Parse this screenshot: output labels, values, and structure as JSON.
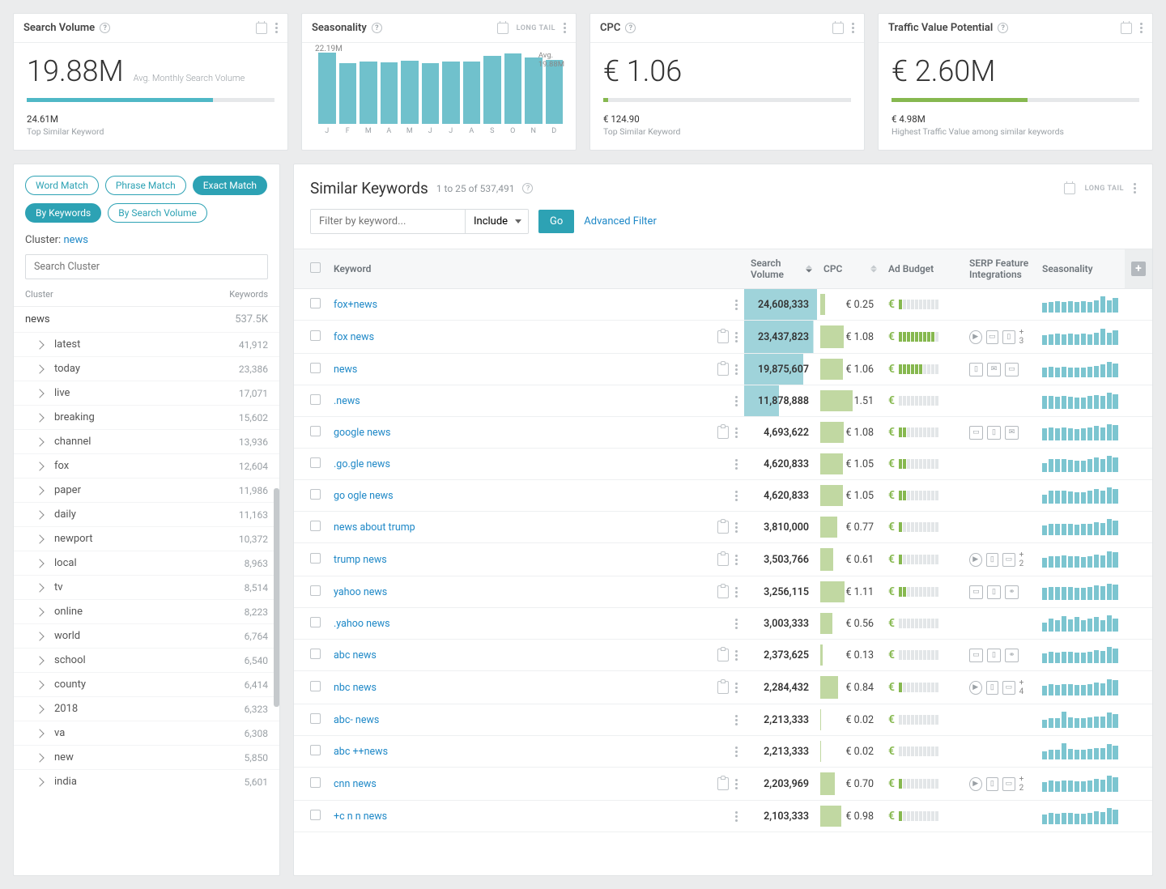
{
  "cards": {
    "searchVolume": {
      "title": "Search Volume",
      "value": "19.88M",
      "sub": "Avg. Monthly Search Volume",
      "foot": "24.61M",
      "footSub": "Top Similar Keyword",
      "fill": 75
    },
    "seasonality": {
      "title": "Seasonality",
      "peak": "22.19M",
      "avgLabel": "Avg.",
      "avg": "19.88M"
    },
    "cpc": {
      "title": "CPC",
      "value": "€ 1.06",
      "foot": "€ 124.90",
      "footSub": "Top Similar Keyword",
      "fill": 2
    },
    "traffic": {
      "title": "Traffic Value Potential",
      "value": "€ 2.60M",
      "foot": "€ 4.98M",
      "footSub": "Highest Traffic Value among similar keywords",
      "fill": 55
    }
  },
  "chart_data": {
    "type": "bar",
    "categories": [
      "J",
      "F",
      "M",
      "A",
      "M",
      "J",
      "J",
      "A",
      "S",
      "O",
      "N",
      "D"
    ],
    "values": [
      22.19,
      18.9,
      19.5,
      19.1,
      19.6,
      19.0,
      19.4,
      19.3,
      21.3,
      22.0,
      20.8,
      20.0
    ],
    "title": "Seasonality",
    "ylim": [
      0,
      22.19
    ],
    "avg": 19.88
  },
  "sidebar": {
    "match": {
      "word": "Word Match",
      "phrase": "Phrase Match",
      "exact": "Exact Match"
    },
    "by": {
      "keywords": "By Keywords",
      "volume": "By Search Volume"
    },
    "clusterLabel": "Cluster:",
    "clusterValue": "news",
    "searchPlaceholder": "Search Cluster",
    "headCluster": "Cluster",
    "headKw": "Keywords",
    "root": {
      "name": "news",
      "count": "537.5K"
    },
    "items": [
      {
        "name": "latest",
        "count": "41,912"
      },
      {
        "name": "today",
        "count": "23,386"
      },
      {
        "name": "live",
        "count": "17,071"
      },
      {
        "name": "breaking",
        "count": "15,602"
      },
      {
        "name": "channel",
        "count": "13,936"
      },
      {
        "name": "fox",
        "count": "12,604"
      },
      {
        "name": "paper",
        "count": "11,986"
      },
      {
        "name": "daily",
        "count": "11,163"
      },
      {
        "name": "newport",
        "count": "10,372"
      },
      {
        "name": "local",
        "count": "8,963"
      },
      {
        "name": "tv",
        "count": "8,514"
      },
      {
        "name": "online",
        "count": "8,223"
      },
      {
        "name": "world",
        "count": "6,764"
      },
      {
        "name": "school",
        "count": "6,540"
      },
      {
        "name": "county",
        "count": "6,414"
      },
      {
        "name": "2018",
        "count": "6,323"
      },
      {
        "name": "va",
        "count": "6,308"
      },
      {
        "name": "new",
        "count": "5,850"
      },
      {
        "name": "india",
        "count": "5,601"
      }
    ]
  },
  "main": {
    "title": "Similar Keywords",
    "count": "1 to 25 of 537,491",
    "filterPlaceholder": "Filter by keyword...",
    "include": "Include",
    "go": "Go",
    "advanced": "Advanced Filter",
    "longtail": "LONG TAIL",
    "headers": {
      "keyword": "Keyword",
      "sv": "Search Volume",
      "cpc": "CPC",
      "budget": "Ad Budget",
      "serp": "SERP Feature Integrations",
      "season": "Seasonality"
    }
  },
  "rows": [
    {
      "kw": "fox+news",
      "sv": "24,608,333",
      "svw": 100,
      "cpc": "€ 0.25",
      "cw": 8,
      "bud": 1,
      "serp": [],
      "more": "",
      "s": [
        60,
        64,
        68,
        66,
        70,
        66,
        68,
        66,
        74,
        100,
        76,
        90
      ],
      "clip": false
    },
    {
      "kw": "fox news",
      "sv": "23,437,823",
      "svw": 95,
      "cpc": "€ 1.08",
      "cw": 36,
      "bud": 9,
      "serp": [
        "play",
        "card",
        "phone"
      ],
      "more": "+ 3",
      "s": [
        60,
        64,
        68,
        66,
        70,
        66,
        68,
        66,
        74,
        100,
        76,
        90
      ],
      "clip": true
    },
    {
      "kw": "news",
      "sv": "19,875,607",
      "svw": 81,
      "cpc": "€ 1.06",
      "cw": 35,
      "bud": 6,
      "serp": [
        "phone",
        "chat",
        "card"
      ],
      "more": "",
      "s": [
        58,
        64,
        62,
        64,
        60,
        58,
        60,
        64,
        70,
        78,
        94,
        86
      ],
      "clip": true
    },
    {
      "kw": ".news",
      "sv": "11,878,888",
      "svw": 48,
      "cpc": "€ 1.51",
      "cw": 50,
      "bud": 0,
      "serp": [],
      "more": "",
      "s": [
        78,
        82,
        74,
        78,
        76,
        72,
        70,
        78,
        86,
        80,
        100,
        92
      ],
      "clip": false
    },
    {
      "kw": "google news",
      "sv": "4,693,622",
      "svw": 19,
      "cpc": "€ 1.08",
      "cw": 36,
      "bud": 2,
      "serp": [
        "card",
        "phone",
        "chat"
      ],
      "more": "",
      "s": [
        74,
        80,
        76,
        80,
        76,
        72,
        74,
        80,
        88,
        82,
        100,
        94
      ],
      "clip": true
    },
    {
      "kw": ".go.gle news",
      "sv": "4,620,833",
      "svw": 19,
      "cpc": "€ 1.05",
      "cw": 35,
      "bud": 2,
      "serp": [],
      "more": "",
      "s": [
        54,
        80,
        78,
        80,
        74,
        70,
        72,
        78,
        90,
        82,
        100,
        92
      ],
      "clip": false
    },
    {
      "kw": "go ogle news",
      "sv": "4,620,833",
      "svw": 19,
      "cpc": "€ 1.05",
      "cw": 35,
      "bud": 2,
      "serp": [],
      "more": "",
      "s": [
        54,
        80,
        78,
        80,
        74,
        70,
        72,
        78,
        90,
        82,
        100,
        92
      ],
      "clip": false
    },
    {
      "kw": "news about trump",
      "sv": "3,810,000",
      "svw": 15,
      "cpc": "€ 0.77",
      "cw": 26,
      "bud": 1,
      "serp": [],
      "more": "",
      "s": [
        60,
        72,
        68,
        72,
        70,
        66,
        68,
        70,
        78,
        74,
        100,
        92
      ],
      "clip": true
    },
    {
      "kw": "trump news",
      "sv": "3,503,766",
      "svw": 14,
      "cpc": "€ 0.61",
      "cw": 20,
      "bud": 1,
      "serp": [
        "play",
        "phone",
        "card"
      ],
      "more": "+ 2",
      "s": [
        60,
        72,
        70,
        76,
        72,
        68,
        66,
        70,
        78,
        74,
        100,
        94
      ],
      "clip": true
    },
    {
      "kw": "yahoo news",
      "sv": "3,256,115",
      "svw": 13,
      "cpc": "€ 1.11",
      "cw": 37,
      "bud": 2,
      "serp": [
        "card",
        "phone",
        "link"
      ],
      "more": "",
      "s": [
        76,
        82,
        80,
        82,
        78,
        76,
        76,
        80,
        88,
        84,
        100,
        94
      ],
      "clip": true
    },
    {
      "kw": ".yahoo news",
      "sv": "3,003,333",
      "svw": 12,
      "cpc": "€ 0.56",
      "cw": 19,
      "bud": 0,
      "serp": [],
      "more": "",
      "s": [
        56,
        78,
        72,
        94,
        76,
        88,
        72,
        78,
        90,
        70,
        100,
        78
      ],
      "clip": false
    },
    {
      "kw": "abc news",
      "sv": "2,373,625",
      "svw": 10,
      "cpc": "€ 0.13",
      "cw": 4,
      "bud": 0,
      "serp": [
        "card",
        "phone",
        "link"
      ],
      "more": "",
      "s": [
        60,
        68,
        66,
        72,
        68,
        64,
        66,
        70,
        78,
        74,
        100,
        92
      ],
      "clip": true
    },
    {
      "kw": "nbc news",
      "sv": "2,284,432",
      "svw": 9,
      "cpc": "€ 0.84",
      "cw": 28,
      "bud": 1,
      "serp": [
        "play",
        "phone",
        "card"
      ],
      "more": "+ 4",
      "s": [
        60,
        68,
        66,
        72,
        68,
        64,
        66,
        70,
        78,
        74,
        100,
        94
      ],
      "clip": true
    },
    {
      "kw": "abc- news",
      "sv": "2,213,333",
      "svw": 9,
      "cpc": "€ 0.02",
      "cw": 1,
      "bud": 0,
      "serp": [],
      "more": "",
      "s": [
        52,
        62,
        60,
        100,
        64,
        60,
        58,
        64,
        72,
        68,
        94,
        86
      ],
      "clip": false
    },
    {
      "kw": "abc ++news",
      "sv": "2,213,333",
      "svw": 9,
      "cpc": "€ 0.02",
      "cw": 1,
      "bud": 0,
      "serp": [],
      "more": "",
      "s": [
        52,
        62,
        60,
        100,
        64,
        60,
        58,
        64,
        72,
        68,
        94,
        86
      ],
      "clip": false
    },
    {
      "kw": "cnn news",
      "sv": "2,203,969",
      "svw": 9,
      "cpc": "€ 0.70",
      "cw": 23,
      "bud": 1,
      "serp": [
        "play",
        "phone",
        "card"
      ],
      "more": "+ 2",
      "s": [
        60,
        68,
        66,
        72,
        68,
        64,
        66,
        70,
        78,
        74,
        100,
        92
      ],
      "clip": true
    },
    {
      "kw": "+c n n news",
      "sv": "2,103,333",
      "svw": 9,
      "cpc": "€ 0.98",
      "cw": 33,
      "bud": 1,
      "serp": [],
      "more": "",
      "s": [
        60,
        68,
        66,
        72,
        68,
        64,
        66,
        70,
        78,
        74,
        100,
        92
      ],
      "clip": false
    }
  ]
}
